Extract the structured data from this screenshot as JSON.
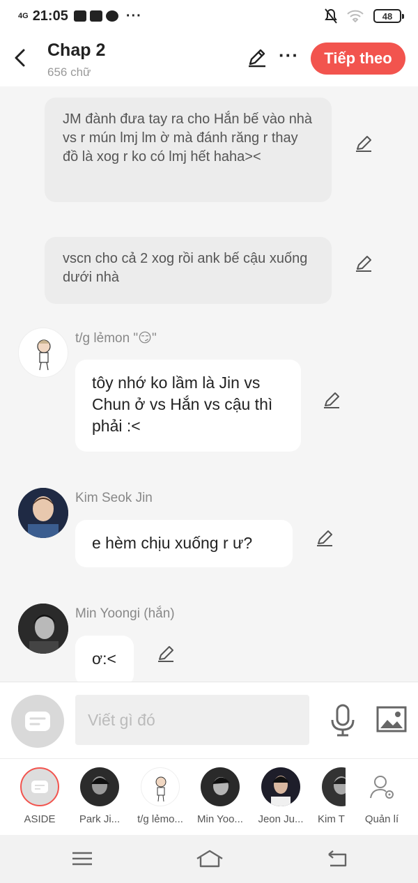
{
  "status": {
    "network": "4G",
    "time": "21:05",
    "battery": "48",
    "more": "···"
  },
  "header": {
    "title": "Chap 2",
    "word_count": "656 chữ",
    "next_label": "Tiếp theo",
    "more": "···"
  },
  "messages": [
    {
      "kind": "narration",
      "text": "JM đành đưa tay ra cho Hắn bế vào nhà vs r mún lmj lm ờ mà đánh răng r thay đồ là xog r ko có lmj hết haha><"
    },
    {
      "kind": "narration",
      "text": "vscn cho cả 2 xog rồi ank bế cậu xuống dưới nhà"
    },
    {
      "kind": "character",
      "name": "t/g lẻmon \"😏\"",
      "text": "tôy nhớ ko lầm là Jin vs Chun ở vs Hắn vs cậu thì phải :<"
    },
    {
      "kind": "character",
      "name": "Kim Seok Jin",
      "text": "e hèm chịu xuống r ư?"
    },
    {
      "kind": "character",
      "name": "Min Yoongi (hắn)",
      "text": "ơ:<"
    }
  ],
  "composer": {
    "placeholder": "Viết gì đó"
  },
  "characters": [
    {
      "label": "ASIDE"
    },
    {
      "label": "Park Ji..."
    },
    {
      "label": "t/g lẻmo..."
    },
    {
      "label": "Min Yoo..."
    },
    {
      "label": "Jeon Ju..."
    },
    {
      "label": "Kim T"
    },
    {
      "label": "Quản lí"
    }
  ],
  "colors": {
    "accent": "#f2544e",
    "narration_bg": "#ececec",
    "bubble_bg": "#ffffff",
    "page_bg": "#f5f5f5"
  }
}
